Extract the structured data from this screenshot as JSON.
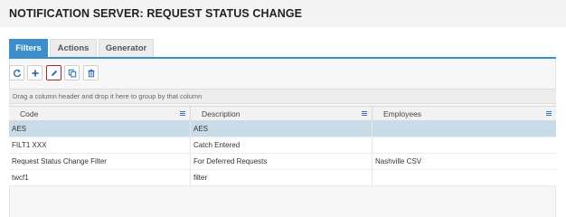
{
  "page": {
    "title": "NOTIFICATION SERVER: REQUEST STATUS CHANGE"
  },
  "tabs": [
    {
      "label": "Filters",
      "active": true
    },
    {
      "label": "Actions",
      "active": false
    },
    {
      "label": "Generator",
      "active": false
    }
  ],
  "toolbar": {
    "buttons": [
      {
        "icon": "refresh-icon"
      },
      {
        "icon": "plus-icon"
      },
      {
        "icon": "pencil-icon",
        "selected": true
      },
      {
        "icon": "copy-icon"
      },
      {
        "icon": "trash-icon"
      }
    ]
  },
  "grid": {
    "group_hint": "Drag a column header and drop it here to group by that column",
    "columns": [
      "Code",
      "Description",
      "Employees"
    ],
    "rows": [
      {
        "code": "AES",
        "description": "AES",
        "employees": "",
        "selected": true
      },
      {
        "code": "FILT1 XXX",
        "description": "Catch Entered",
        "employees": ""
      },
      {
        "code": "Request Status Change Filter",
        "description": "For Deferred Requests",
        "employees": "Nashville CSV"
      },
      {
        "code": "twcf1",
        "description": "filter",
        "employees": ""
      }
    ]
  },
  "colors": {
    "accent": "#3c8dcb",
    "selected_row": "#c8dbe9",
    "selected_button_border": "#b3222c"
  }
}
